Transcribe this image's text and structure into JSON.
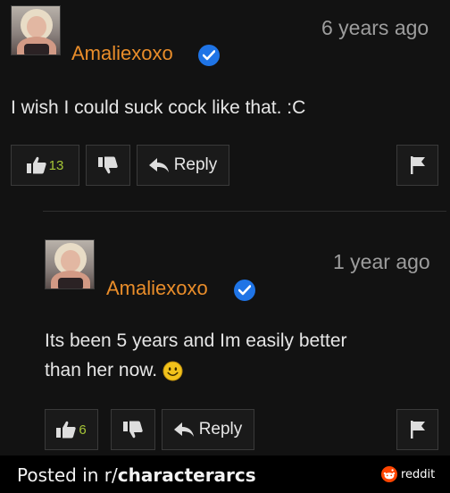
{
  "comment1": {
    "username": "Amaliexoxo",
    "time": "6 years ago",
    "text": "I wish I could suck cock like that. :C",
    "like_count": "13",
    "reply_label": "Reply"
  },
  "comment2": {
    "username": "Amaliexoxo",
    "time": "1 year ago",
    "text_line1": "Its been 5 years and Im easily better",
    "text_line2": "than her now.",
    "like_count": "6",
    "reply_label": "Reply"
  },
  "footer": {
    "prefix": "Posted in r/",
    "subreddit": "characterarcs",
    "brand": "reddit"
  },
  "colors": {
    "username": "#e98d2a",
    "verified": "#1f74e6",
    "like_count": "#a6c637",
    "background": "#121212"
  },
  "icons": [
    "thumbs-up-icon",
    "thumbs-down-icon",
    "reply-arrow-icon",
    "flag-icon",
    "verified-check-icon",
    "smiley-emoji-icon",
    "reddit-logo-icon"
  ]
}
